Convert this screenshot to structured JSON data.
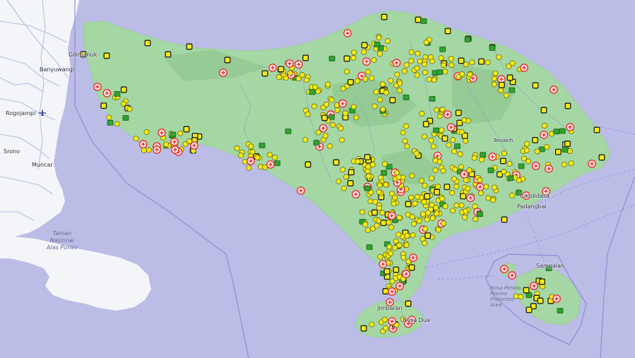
{
  "map": {
    "colors": {
      "sea": "#bcbde6",
      "land_bali": "#a4d7a4",
      "land_java": "#f4f5f9",
      "java_roads": "#b7c1dc",
      "marker_yellow": "#f2ea12",
      "marker_green": "#2fa32f",
      "marker_red_ring": "#e62e2e",
      "boundary": "#8d8fd6"
    },
    "labels": {
      "gilimanuk": "Gilimanuk",
      "banyuwangi": "Banyuwangi",
      "rogojampi": "Rogojampi",
      "srono": "Srono",
      "muncar": "Muncar",
      "candidasa": "Candidasa",
      "padangbai": "Padangbai",
      "besakih": "Besakih",
      "sampalan": "Sampalan",
      "jimbaran": "Jimbaran",
      "nusa_dua": "Nusa Dua",
      "taman_line1": "Taman",
      "taman_line2": "Nasional",
      "taman_line3": "Alas Purwo",
      "nusa_line1": "Nusa Penida",
      "nusa_line2": "Marine",
      "nusa_line3": "Protected",
      "nusa_line4": "Area"
    },
    "icons": {
      "airport": "airport-icon",
      "hospital": "hospital-icon",
      "clinic": "clinic-icon",
      "pharmacy": "pharmacy-icon",
      "dot": "poi-dot-icon"
    }
  }
}
